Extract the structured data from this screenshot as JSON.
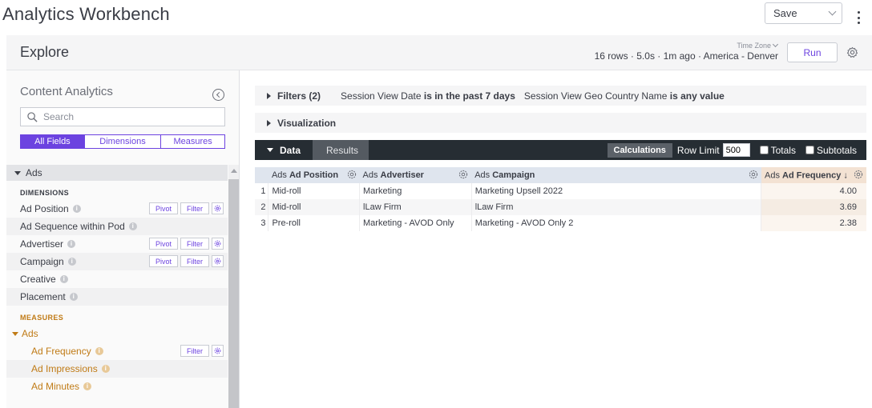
{
  "app": {
    "title": "Analytics Workbench",
    "save_label": "Save"
  },
  "explore": {
    "title": "Explore",
    "timezone_label": "Time Zone",
    "run_meta": "16 rows · 5.0s · 1m ago · America - Denver",
    "run_label": "Run"
  },
  "left_panel": {
    "title": "Content Analytics",
    "search_placeholder": "Search",
    "tabs": [
      "All Fields",
      "Dimensions",
      "Measures"
    ],
    "group": "Ads",
    "dimensions_label": "DIMENSIONS",
    "dimensions": [
      {
        "label": "Ad Position",
        "pivot": "Pivot",
        "filter": "Filter"
      },
      {
        "label": "Ad Sequence within Pod"
      },
      {
        "label": "Advertiser",
        "pivot": "Pivot",
        "filter": "Filter"
      },
      {
        "label": "Campaign",
        "pivot": "Pivot",
        "filter": "Filter"
      },
      {
        "label": "Creative"
      },
      {
        "label": "Placement"
      }
    ],
    "measures_label": "MEASURES",
    "measures_group": "Ads",
    "measures": [
      {
        "label": "Ad Frequency",
        "filter": "Filter"
      },
      {
        "label": "Ad Impressions"
      },
      {
        "label": "Ad Minutes"
      }
    ],
    "info_glyph": "i"
  },
  "filters_bar": {
    "title": "Filters (2)",
    "filter1_field": "Session View Date",
    "filter1_cond": "is in the past 7 days",
    "filter2_field": "Session View Geo Country Name",
    "filter2_cond": "is any value"
  },
  "visualization_bar": {
    "title": "Visualization"
  },
  "data_bar": {
    "data_tab": "Data",
    "results_tab": "Results",
    "calculations": "Calculations",
    "row_limit_label": "Row Limit",
    "row_limit_value": "500",
    "totals_label": "Totals",
    "subtotals_label": "Subtotals"
  },
  "table": {
    "columns": [
      {
        "prefix": "Ads",
        "name": "Ad Position"
      },
      {
        "prefix": "Ads",
        "name": "Advertiser"
      },
      {
        "prefix": "Ads",
        "name": "Campaign"
      },
      {
        "prefix": "Ads",
        "name": "Ad Frequency ↓"
      }
    ],
    "rows": [
      {
        "idx": "1",
        "position": "Mid-roll",
        "advertiser": "Marketing",
        "campaign": "Marketing Upsell 2022",
        "frequency": "4.00"
      },
      {
        "idx": "2",
        "position": "Mid-roll",
        "advertiser": "lLaw Firm",
        "campaign": "lLaw Firm",
        "frequency": "3.69"
      },
      {
        "idx": "3",
        "position": "Pre-roll",
        "advertiser": "Marketing - AVOD Only",
        "campaign": "Marketing - AVOD Only 2",
        "frequency": "2.38"
      }
    ]
  },
  "colors": {
    "accent": "#6c43e0",
    "measure": "#c07b16",
    "data_bar": "#262d33"
  }
}
